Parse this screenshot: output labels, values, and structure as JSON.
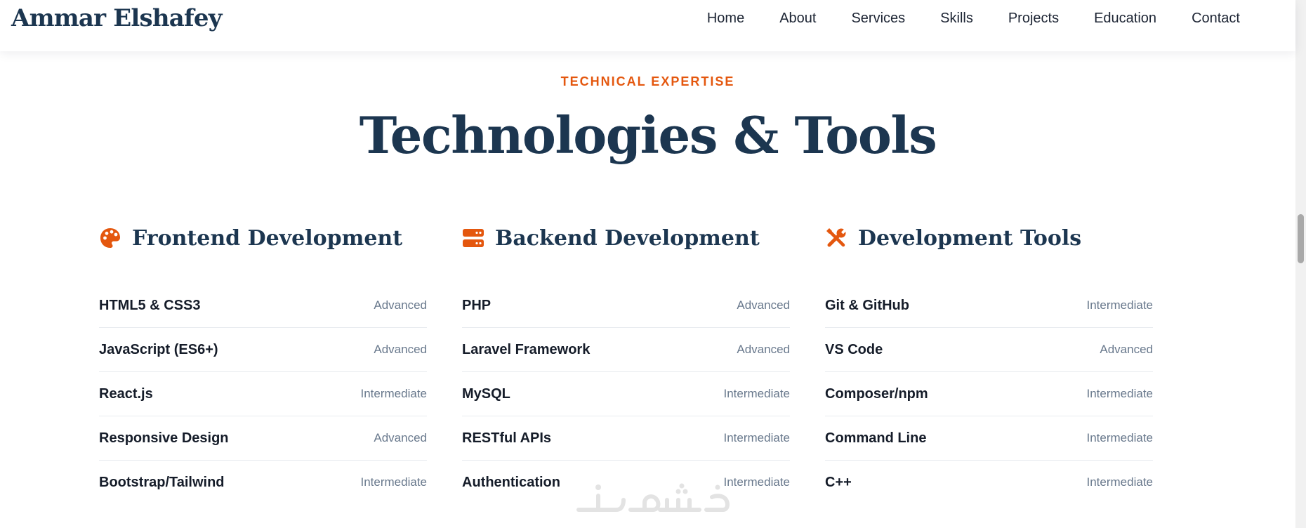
{
  "header": {
    "logo": "Ammar Elshafey",
    "nav": [
      "Home",
      "About",
      "Services",
      "Skills",
      "Projects",
      "Education",
      "Contact"
    ]
  },
  "section": {
    "eyebrow": "TECHNICAL EXPERTISE",
    "title": "Technologies & Tools"
  },
  "columns": [
    {
      "icon": "palette-icon",
      "title": "Frontend Development",
      "skills": [
        {
          "name": "HTML5 & CSS3",
          "level": "Advanced"
        },
        {
          "name": "JavaScript (ES6+)",
          "level": "Advanced"
        },
        {
          "name": "React.js",
          "level": "Intermediate"
        },
        {
          "name": "Responsive Design",
          "level": "Advanced"
        },
        {
          "name": "Bootstrap/Tailwind",
          "level": "Intermediate"
        }
      ]
    },
    {
      "icon": "server-icon",
      "title": "Backend Development",
      "skills": [
        {
          "name": "PHP",
          "level": "Advanced"
        },
        {
          "name": "Laravel Framework",
          "level": "Advanced"
        },
        {
          "name": "MySQL",
          "level": "Intermediate"
        },
        {
          "name": "RESTful APIs",
          "level": "Intermediate"
        },
        {
          "name": "Authentication",
          "level": "Intermediate"
        }
      ]
    },
    {
      "icon": "tools-icon",
      "title": "Development Tools",
      "skills": [
        {
          "name": "Git & GitHub",
          "level": "Intermediate"
        },
        {
          "name": "VS Code",
          "level": "Advanced"
        },
        {
          "name": "Composer/npm",
          "level": "Intermediate"
        },
        {
          "name": "Command Line",
          "level": "Intermediate"
        },
        {
          "name": "C++",
          "level": "Intermediate"
        }
      ]
    }
  ],
  "watermark": "خمسات",
  "colors": {
    "accent": "#e4570e",
    "heading": "#1c3650",
    "text": "#151c29",
    "muted": "#68788c",
    "divider": "#e8ebef"
  }
}
